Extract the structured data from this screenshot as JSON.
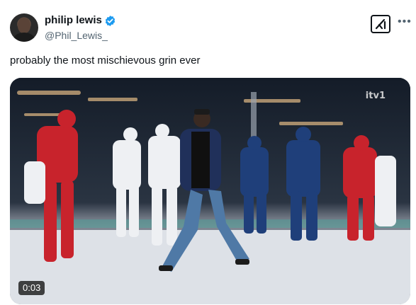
{
  "tweet": {
    "author_name": "philip lewis",
    "author_handle": "@Phil_Lewis_",
    "text": "probably the most mischievous grin ever",
    "video_timestamp": "0:03",
    "broadcaster_watermark": "itv1"
  },
  "icons": {
    "verified": "verified-badge-icon",
    "grok": "grok-icon",
    "more": "more-options-icon"
  },
  "colors": {
    "verified_blue": "#1d9bf0",
    "text_primary": "#0f1419",
    "text_secondary": "#536471"
  }
}
